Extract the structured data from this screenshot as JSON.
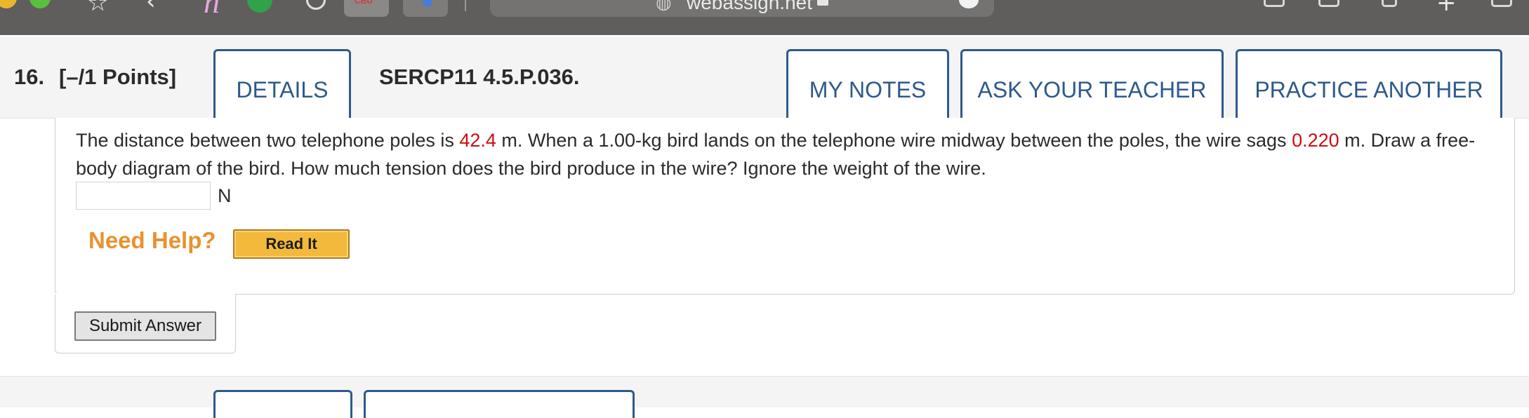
{
  "browser": {
    "url": "webassign.net",
    "tab_badge": "CBU",
    "extension_letter": "n"
  },
  "question": {
    "number": "16.",
    "points": "[–/1 Points]",
    "details_label": "DETAILS",
    "code": "SERCP11 4.5.P.036.",
    "my_notes_label": "MY NOTES",
    "ask_teacher_label": "ASK YOUR TEACHER",
    "practice_another_label": "PRACTICE ANOTHER",
    "text_part1": "The distance between two telephone poles is ",
    "value_distance": "42.4",
    "text_part2": " m. When a 1.00-kg bird lands on the telephone wire midway between the poles, the wire sags ",
    "value_sag": "0.220",
    "text_part3": " m. Draw a free-body diagram of the bird. How much tension does the bird produce in the wire? Ignore the weight of the wire.",
    "answer_value": "",
    "answer_unit": "N",
    "need_help_label": "Need Help?",
    "read_it_label": "Read It",
    "submit_label": "Submit Answer"
  },
  "colors": {
    "accent": "#2d5a8c",
    "value_red": "#cc0f0f",
    "help_orange": "#e8922e",
    "read_it_bg": "#f3b93c"
  }
}
